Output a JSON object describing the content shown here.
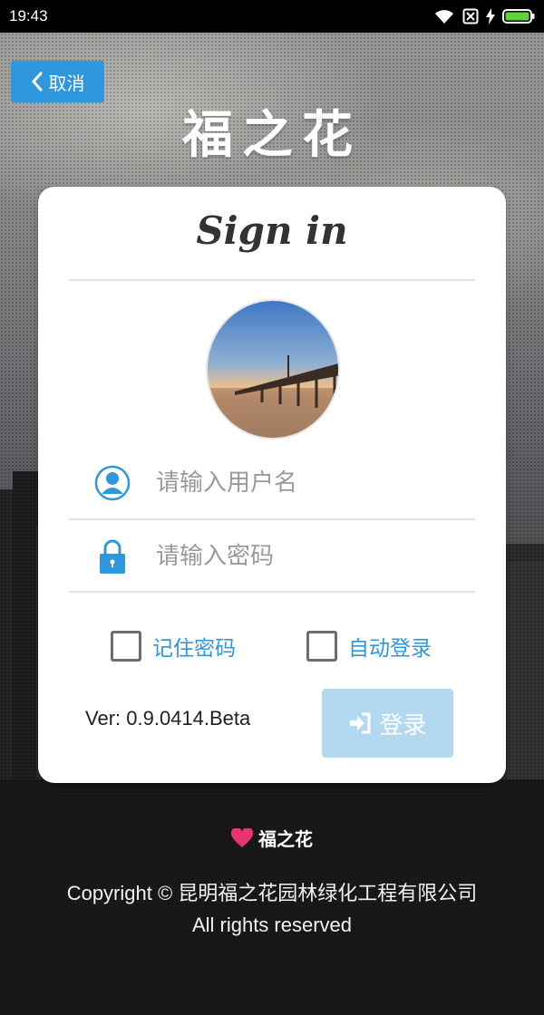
{
  "status_bar": {
    "time": "19:43"
  },
  "header": {
    "cancel_label": "取消",
    "brand_title": "福之花"
  },
  "card": {
    "title": "Sign in",
    "username_placeholder": "请输入用户名",
    "password_placeholder": "请输入密码",
    "remember_label": "记住密码",
    "auto_login_label": "自动登录",
    "version": "Ver: 0.9.0414.Beta",
    "login_label": "登录"
  },
  "footer": {
    "logo_text": "福之花",
    "copyright_line1": "Copyright © 昆明福之花园林绿化工程有限公司",
    "copyright_line2": "All rights reserved"
  },
  "colors": {
    "accent": "#2e97dd",
    "login_button": "#b3d9f1",
    "heart": "#e8356d"
  }
}
